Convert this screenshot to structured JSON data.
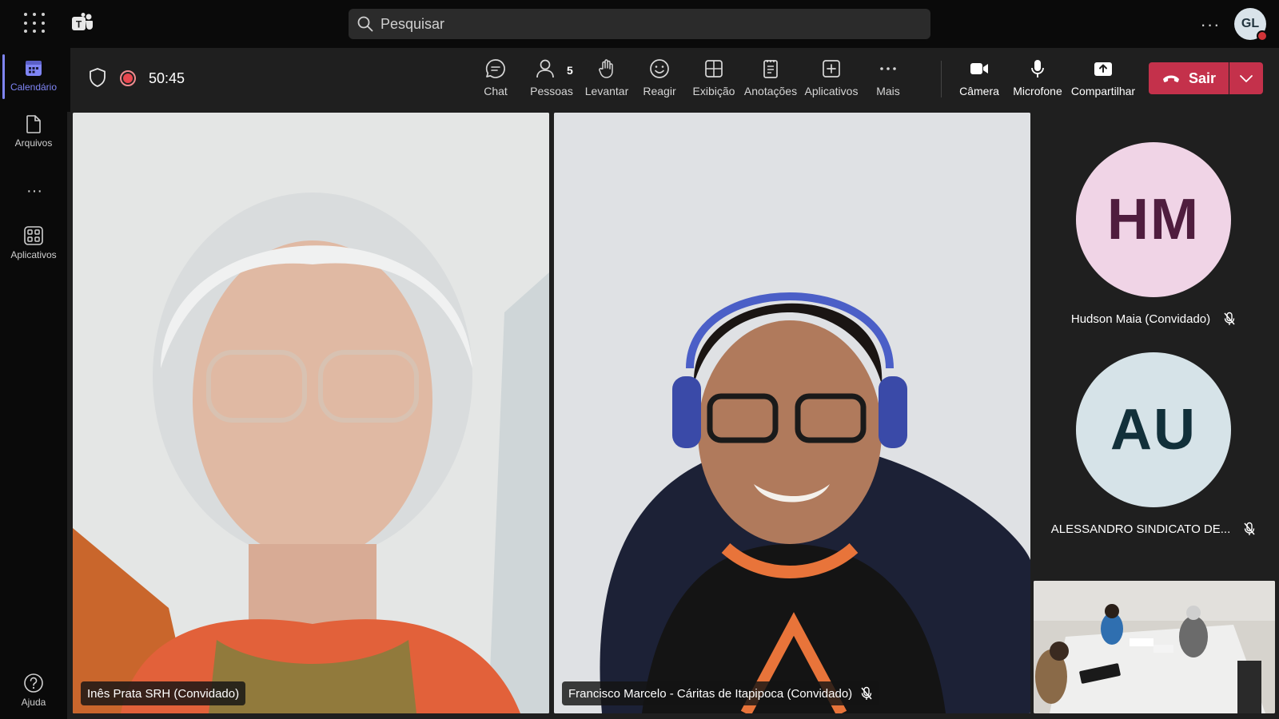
{
  "search": {
    "placeholder": "Pesquisar"
  },
  "user": {
    "initials": "GL"
  },
  "rail": {
    "items": [
      {
        "label": "Calendário",
        "icon": "calendar-icon",
        "active": true
      },
      {
        "label": "Arquivos",
        "icon": "file-icon"
      },
      {
        "label": "Aplicativos",
        "icon": "apps-icon"
      },
      {
        "label": "Ajuda",
        "icon": "help-icon"
      }
    ]
  },
  "meeting": {
    "timer": "50:45",
    "people_count": "5",
    "tools": [
      {
        "label": "Chat",
        "icon": "chat-icon"
      },
      {
        "label": "Pessoas",
        "icon": "people-icon"
      },
      {
        "label": "Levantar",
        "icon": "raise-hand-icon"
      },
      {
        "label": "Reagir",
        "icon": "react-icon"
      },
      {
        "label": "Exibição",
        "icon": "view-icon"
      },
      {
        "label": "Anotações",
        "icon": "notes-icon"
      },
      {
        "label": "Aplicativos",
        "icon": "add-app-icon"
      },
      {
        "label": "Mais",
        "icon": "more-icon"
      },
      {
        "label": "Câmera",
        "icon": "camera-icon"
      },
      {
        "label": "Microfone",
        "icon": "microphone-icon"
      },
      {
        "label": "Compartilhar",
        "icon": "share-icon"
      }
    ],
    "leave_label": "Sair"
  },
  "participants": [
    {
      "name": "Inês Prata SRH (Convidado)",
      "muted": false
    },
    {
      "name": "Francisco Marcelo - Cáritas de Itapipoca (Convidado)",
      "muted": true
    },
    {
      "name": "Hudson Maia (Convidado)",
      "initials": "HM",
      "muted": true,
      "bg": "#f0d4e6",
      "fg": "#4f1d3e"
    },
    {
      "name": "ALESSANDRO SINDICATO DE...",
      "initials": "AU",
      "muted": true,
      "bg": "#d6e3e8",
      "fg": "#12303a"
    }
  ],
  "colors": {
    "accent": "#7f85f5",
    "leave": "#c4314b",
    "record": "#e8474f"
  }
}
